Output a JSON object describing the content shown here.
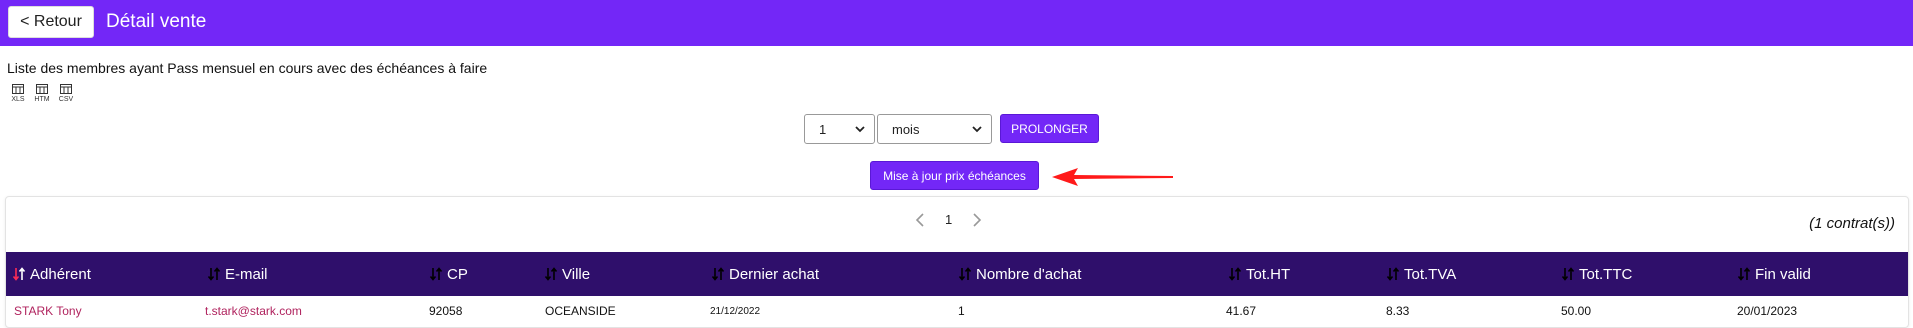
{
  "header": {
    "back_label": "< Retour",
    "title": "Détail vente"
  },
  "description": "Liste des membres ayant Pass mensuel en cours avec des échéances à faire",
  "exports": [
    {
      "label": "XLS",
      "icon": "table-icon"
    },
    {
      "label": "HTM",
      "icon": "table-icon"
    },
    {
      "label": "CSV",
      "icon": "table-icon"
    }
  ],
  "controls": {
    "quantity": "1",
    "unit": "mois",
    "prolong_label": "PROLONGER",
    "update_label": "Mise à jour prix échéances"
  },
  "colors": {
    "brand": "#7327f7",
    "table_header": "#2f0f6b",
    "link": "#b0235e",
    "arrow": "#ff1a1a"
  },
  "pagination": {
    "page": "1",
    "count_text": "(1 contrat(s))"
  },
  "table": {
    "columns": [
      "Adhérent",
      "E-mail",
      "CP",
      "Ville",
      "Dernier achat",
      "Nombre d'achat",
      "Tot.HT",
      "Tot.TVA",
      "Tot.TTC",
      "Fin valid"
    ],
    "rows": [
      [
        "STARK Tony",
        "t.stark@stark.com",
        "92058",
        "OCEANSIDE",
        "21/12/2022",
        "1",
        "41.67",
        "8.33",
        "50.00",
        "20/01/2023"
      ]
    ]
  }
}
